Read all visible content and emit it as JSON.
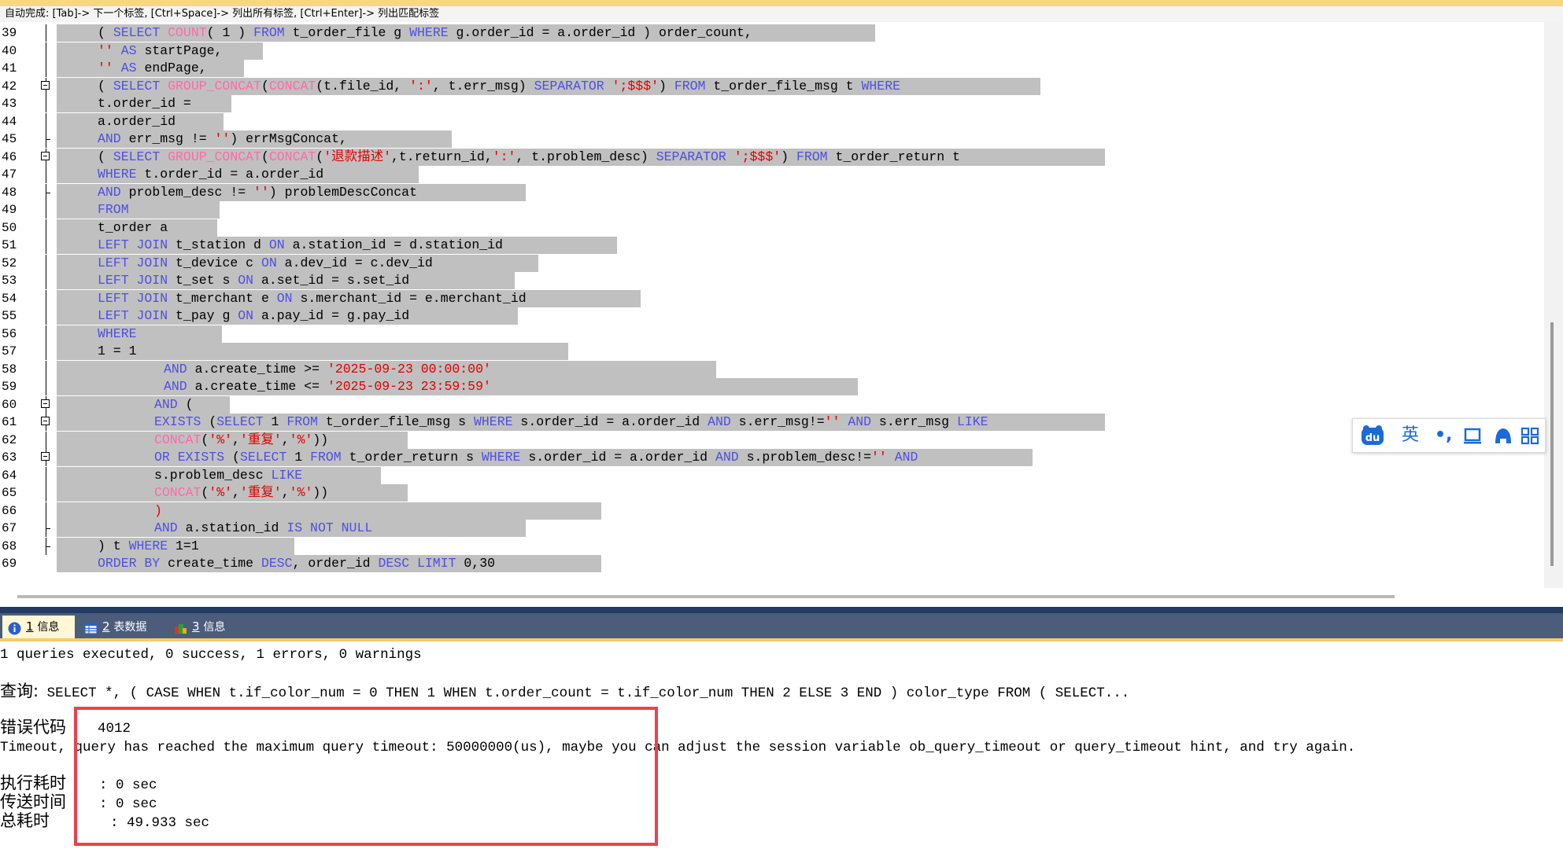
{
  "hint_bar": {
    "text": "自动完成: [Tab]-> 下一个标签, [Ctrl+Space]-> 列出所有标签, [Ctrl+Enter]-> 列出匹配标签"
  },
  "editor": {
    "lines": [
      {
        "n": "39",
        "fold": "line",
        "indent": 124,
        "bgw": 1040,
        "segs": [
          [
            "( ",
            "n"
          ],
          [
            "SELECT ",
            "k"
          ],
          [
            "COUNT",
            "f"
          ],
          [
            "( 1 ) ",
            "n"
          ],
          [
            "FROM ",
            "k"
          ],
          [
            "t_order_file g ",
            "n"
          ],
          [
            "WHERE ",
            "k"
          ],
          [
            "g.order_id = a.order_id ) order_count,",
            "n"
          ]
        ]
      },
      {
        "n": "40",
        "fold": "line",
        "indent": 124,
        "bgw": 262,
        "segs": [
          [
            "'' ",
            "s"
          ],
          [
            "AS ",
            "k"
          ],
          [
            "startPage,",
            "n"
          ]
        ]
      },
      {
        "n": "41",
        "fold": "line",
        "indent": 124,
        "bgw": 238,
        "segs": [
          [
            "'' ",
            "s"
          ],
          [
            "AS ",
            "k"
          ],
          [
            "endPage,",
            "n"
          ]
        ]
      },
      {
        "n": "42",
        "fold": "box",
        "indent": 124,
        "bgw": 1250,
        "segs": [
          [
            "( ",
            "n"
          ],
          [
            "SELECT ",
            "k"
          ],
          [
            "GROUP_CONCAT",
            "f"
          ],
          [
            "(",
            "n"
          ],
          [
            "CONCAT",
            "f"
          ],
          [
            "(t.file_id, ",
            "n"
          ],
          [
            "':'",
            "s"
          ],
          [
            ", t.err_msg) ",
            "n"
          ],
          [
            "SEPARATOR ",
            "k"
          ],
          [
            "';$$$'",
            "s"
          ],
          [
            ") ",
            "n"
          ],
          [
            "FROM ",
            "k"
          ],
          [
            "t_order_file_msg t ",
            "n"
          ],
          [
            "WHERE",
            "k"
          ]
        ]
      },
      {
        "n": "43",
        "fold": "line",
        "indent": 124,
        "bgw": 222,
        "segs": [
          [
            "t.order_id =",
            "n"
          ]
        ]
      },
      {
        "n": "44",
        "fold": "line",
        "indent": 124,
        "bgw": 212,
        "segs": [
          [
            "a.order_id",
            "n"
          ]
        ]
      },
      {
        "n": "45",
        "fold": "tick",
        "indent": 124,
        "bgw": 502,
        "segs": [
          [
            "AND ",
            "k"
          ],
          [
            "err_msg != ",
            "n"
          ],
          [
            "''",
            "s"
          ],
          [
            ") errMsgConcat,",
            "n"
          ]
        ]
      },
      {
        "n": "46",
        "fold": "box",
        "indent": 124,
        "bgw": 1332,
        "segs": [
          [
            "( ",
            "n"
          ],
          [
            "SELECT ",
            "k"
          ],
          [
            "GROUP_CONCAT",
            "f"
          ],
          [
            "(",
            "n"
          ],
          [
            "CONCAT",
            "f"
          ],
          [
            "(",
            "n"
          ],
          [
            "'退款描述'",
            "s"
          ],
          [
            ",t.return_id,",
            "n"
          ],
          [
            "':'",
            "s"
          ],
          [
            ", t.problem_desc) ",
            "n"
          ],
          [
            "SEPARATOR ",
            "k"
          ],
          [
            "';$$$'",
            "s"
          ],
          [
            ") ",
            "n"
          ],
          [
            "FROM ",
            "k"
          ],
          [
            "t_order_return t",
            "n"
          ]
        ]
      },
      {
        "n": "47",
        "fold": "line",
        "indent": 124,
        "bgw": 460,
        "segs": [
          [
            "WHERE ",
            "k"
          ],
          [
            "t.order_id = a.order_id",
            "n"
          ]
        ]
      },
      {
        "n": "48",
        "fold": "tick",
        "indent": 124,
        "bgw": 596,
        "segs": [
          [
            "AND ",
            "k"
          ],
          [
            "problem_desc != ",
            "n"
          ],
          [
            "''",
            "s"
          ],
          [
            ") problemDescConcat",
            "n"
          ]
        ]
      },
      {
        "n": "49",
        "fold": "line",
        "indent": 124,
        "bgw": 207,
        "segs": [
          [
            "FROM",
            "k"
          ]
        ]
      },
      {
        "n": "50",
        "fold": "line",
        "indent": 124,
        "bgw": 204,
        "segs": [
          [
            "t_order a",
            "n"
          ]
        ]
      },
      {
        "n": "51",
        "fold": "line",
        "indent": 124,
        "bgw": 712,
        "segs": [
          [
            "LEFT JOIN ",
            "k"
          ],
          [
            "t_station d ",
            "n"
          ],
          [
            "ON ",
            "k"
          ],
          [
            "a.station_id = d.station_id",
            "n"
          ]
        ]
      },
      {
        "n": "52",
        "fold": "line",
        "indent": 124,
        "bgw": 612,
        "segs": [
          [
            "LEFT JOIN ",
            "k"
          ],
          [
            "t_device c ",
            "n"
          ],
          [
            "ON ",
            "k"
          ],
          [
            "a.dev_id = c.dev_id",
            "n"
          ]
        ]
      },
      {
        "n": "53",
        "fold": "line",
        "indent": 124,
        "bgw": 582,
        "segs": [
          [
            "LEFT JOIN ",
            "k"
          ],
          [
            "t_set s ",
            "n"
          ],
          [
            "ON ",
            "k"
          ],
          [
            "a.set_id = s.set_id",
            "n"
          ]
        ]
      },
      {
        "n": "54",
        "fold": "line",
        "indent": 124,
        "bgw": 742,
        "segs": [
          [
            "LEFT JOIN ",
            "k"
          ],
          [
            "t_merchant e ",
            "n"
          ],
          [
            "ON ",
            "k"
          ],
          [
            "s.merchant_id = e.merchant_id",
            "n"
          ]
        ]
      },
      {
        "n": "55",
        "fold": "line",
        "indent": 124,
        "bgw": 586,
        "segs": [
          [
            "LEFT JOIN ",
            "k"
          ],
          [
            "t_pay g ",
            "n"
          ],
          [
            "ON ",
            "k"
          ],
          [
            "a.pay_id = g.pay_id",
            "n"
          ]
        ]
      },
      {
        "n": "56",
        "fold": "line",
        "indent": 124,
        "bgw": 210,
        "segs": [
          [
            "WHERE",
            "k"
          ]
        ]
      },
      {
        "n": "57",
        "fold": "line",
        "indent": 124,
        "bgw": 650,
        "segs": [
          [
            "1 = 1",
            "n"
          ]
        ]
      },
      {
        "n": "58",
        "fold": "line",
        "indent": 208,
        "bgw": 838,
        "segs": [
          [
            "AND ",
            "k"
          ],
          [
            "a.create_time >= ",
            "n"
          ],
          [
            "'2025-09-23 00:00:00'",
            "s"
          ]
        ]
      },
      {
        "n": "59",
        "fold": "line",
        "indent": 208,
        "bgw": 1018,
        "segs": [
          [
            "AND ",
            "k"
          ],
          [
            "a.create_time <= ",
            "n"
          ],
          [
            "'2025-09-23 23:59:59'",
            "s"
          ]
        ]
      },
      {
        "n": "60",
        "fold": "box",
        "indent": 196,
        "bgw": 220,
        "segs": [
          [
            "AND ",
            "k"
          ],
          [
            "(",
            "n"
          ]
        ]
      },
      {
        "n": "61",
        "fold": "box",
        "indent": 196,
        "bgw": 1332,
        "segs": [
          [
            "EXISTS ",
            "k"
          ],
          [
            "(",
            "n"
          ],
          [
            "SELECT ",
            "k"
          ],
          [
            "1 ",
            "n"
          ],
          [
            "FROM ",
            "k"
          ],
          [
            "t_order_file_msg s ",
            "n"
          ],
          [
            "WHERE ",
            "k"
          ],
          [
            "s.order_id = a.order_id ",
            "n"
          ],
          [
            "AND ",
            "k"
          ],
          [
            "s.err_msg!=",
            "n"
          ],
          [
            "'' ",
            "s"
          ],
          [
            "AND ",
            "k"
          ],
          [
            "s.err_msg ",
            "n"
          ],
          [
            "LIKE",
            "k"
          ]
        ]
      },
      {
        "n": "62",
        "fold": "line",
        "indent": 196,
        "bgw": 446,
        "segs": [
          [
            "CONCAT",
            "f"
          ],
          [
            "(",
            "n"
          ],
          [
            "'%'",
            "s"
          ],
          [
            ",",
            "n"
          ],
          [
            "'重复'",
            "s"
          ],
          [
            ",",
            "n"
          ],
          [
            "'%'",
            "s"
          ],
          [
            "))",
            "n"
          ]
        ]
      },
      {
        "n": "63",
        "fold": "box",
        "indent": 196,
        "bgw": 1240,
        "segs": [
          [
            "OR EXISTS ",
            "k"
          ],
          [
            "(",
            "n"
          ],
          [
            "SELECT ",
            "k"
          ],
          [
            "1 ",
            "n"
          ],
          [
            "FROM ",
            "k"
          ],
          [
            "t_order_return s ",
            "n"
          ],
          [
            "WHERE ",
            "k"
          ],
          [
            "s.order_id = a.order_id ",
            "n"
          ],
          [
            "AND ",
            "k"
          ],
          [
            "s.problem_desc!=",
            "n"
          ],
          [
            "'' ",
            "s"
          ],
          [
            "AND",
            "k"
          ]
        ]
      },
      {
        "n": "64",
        "fold": "line",
        "indent": 196,
        "bgw": 412,
        "segs": [
          [
            "s.problem_desc ",
            "n"
          ],
          [
            "LIKE",
            "k"
          ]
        ]
      },
      {
        "n": "65",
        "fold": "line",
        "indent": 196,
        "bgw": 446,
        "segs": [
          [
            "CONCAT",
            "f"
          ],
          [
            "(",
            "n"
          ],
          [
            "'%'",
            "s"
          ],
          [
            ",",
            "n"
          ],
          [
            "'重复'",
            "s"
          ],
          [
            ",",
            "n"
          ],
          [
            "'%'",
            "s"
          ],
          [
            "))",
            "n"
          ]
        ]
      },
      {
        "n": "66",
        "fold": "line",
        "indent": 196,
        "bgw": 692,
        "segs": [
          [
            ")",
            "s"
          ]
        ]
      },
      {
        "n": "67",
        "fold": "tick",
        "indent": 196,
        "bgw": 596,
        "segs": [
          [
            "AND ",
            "k"
          ],
          [
            "a.station_id ",
            "n"
          ],
          [
            "IS NOT NULL",
            "k"
          ]
        ]
      },
      {
        "n": "68",
        "fold": "tick",
        "indent": 124,
        "bgw": 302,
        "segs": [
          [
            ") t ",
            "n"
          ],
          [
            "WHERE ",
            "k"
          ],
          [
            "1=1",
            "n"
          ]
        ]
      },
      {
        "n": "69",
        "fold": "none",
        "indent": 124,
        "bgw": 692,
        "segs": [
          [
            "ORDER BY ",
            "k"
          ],
          [
            "create_time ",
            "n"
          ],
          [
            "DESC",
            "k"
          ],
          [
            ", order_id ",
            "n"
          ],
          [
            "DESC LIMIT ",
            "k"
          ],
          [
            "0,30",
            "n"
          ]
        ]
      }
    ]
  },
  "tabs": [
    {
      "num": "1",
      "label": "信息"
    },
    {
      "num": "2",
      "label": "表数据"
    },
    {
      "num": "3",
      "label": "信息"
    }
  ],
  "results": {
    "summary": "1 queries executed, 0 success, 1 errors, 0 warnings",
    "query_label": "查询:",
    "query_text": " SELECT *, ( CASE WHEN t.if_color_num = 0 THEN 1 WHEN t.order_count = t.if_color_num THEN 2 ELSE 3 END ) color_type FROM ( SELECT...",
    "error_code_label": "错误代码",
    "error_code": "4012",
    "error_message": "Timeout, query has reached the maximum query timeout: 50000000(us), maybe you can adjust the session variable ob_query_timeout or query_timeout hint, and try again.",
    "exec_time_label": "执行耗时",
    "exec_time": ": 0 sec",
    "transfer_time_label": "传送时间",
    "transfer_time": ": 0 sec",
    "total_time_label": "总耗时",
    "total_time": ": 49.933 sec"
  },
  "ime_toolbar": {
    "lang_label": "英",
    "punct_label": "•,"
  }
}
